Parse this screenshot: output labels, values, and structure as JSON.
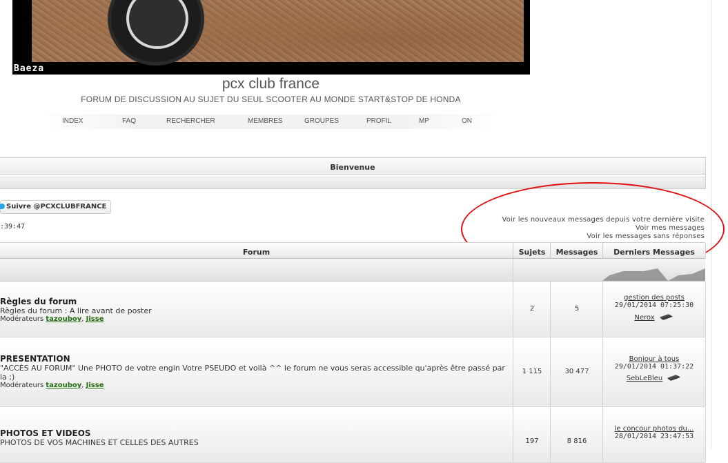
{
  "banner": {
    "caption": "Baeza"
  },
  "site": {
    "title": "pcx club france",
    "description": "FORUM DE DISCUSSION AU SUJET DU SEUL SCOOTER AU MONDE START&STOP DE HONDA"
  },
  "nav": {
    "items": [
      {
        "label": "INDEX"
      },
      {
        "label": "FAQ"
      },
      {
        "label": "RECHERCHER"
      },
      {
        "label": "MEMBRES"
      },
      {
        "label": "GROUPES"
      },
      {
        "label": "PROFIL"
      },
      {
        "label": "MP"
      },
      {
        "label": "ON"
      }
    ]
  },
  "welcome": {
    "title": "Bienvenue"
  },
  "twitter": {
    "label": "Suivre @PCXCLUBFRANCE"
  },
  "clock": {
    "time": ":39:47"
  },
  "quick_links": [
    "Voir les nouveaux messages depuis votre dernière visite",
    "Voir mes messages",
    "Voir les messages sans réponses"
  ],
  "table": {
    "headers": {
      "forum": "Forum",
      "topics": "Sujets",
      "posts": "Messages",
      "last": "Derniers Messages"
    },
    "mods_label": "Modérateurs",
    "rows": [
      {
        "name": "Règles du forum",
        "desc": "Règles du forum : A lire avant de poster",
        "mods": [
          "tazouboy",
          "Jisse"
        ],
        "topics": "2",
        "posts": "5",
        "last_title": "gestion des posts",
        "last_date": "29/01/2014 07:25:30",
        "last_user": "Nerox"
      },
      {
        "name": "PRESENTATION",
        "desc": "\"ACCÈS AU FORUM\" Une PHOTO de votre engin Votre PSEUDO et voilà ^^ le forum ne vous seras accessible qu'après être passé par la ;)",
        "mods": [
          "tazouboy",
          "Jisse"
        ],
        "topics": "1 115",
        "posts": "30 477",
        "last_title": "Bonjour à tous",
        "last_date": "29/01/2014 01:37:22",
        "last_user": "SebLeBleu"
      },
      {
        "name": "PHOTOS ET VIDEOS",
        "desc": "PHOTOS DE VOS MACHINES ET CELLES DES AUTRES",
        "topics": "197",
        "posts": "8 816",
        "last_title": "le concour photos du...",
        "last_date": "28/01/2014 23:47:53"
      }
    ]
  },
  "colors": {
    "annotation": "#e01010",
    "moderator_link": "#236b10"
  }
}
